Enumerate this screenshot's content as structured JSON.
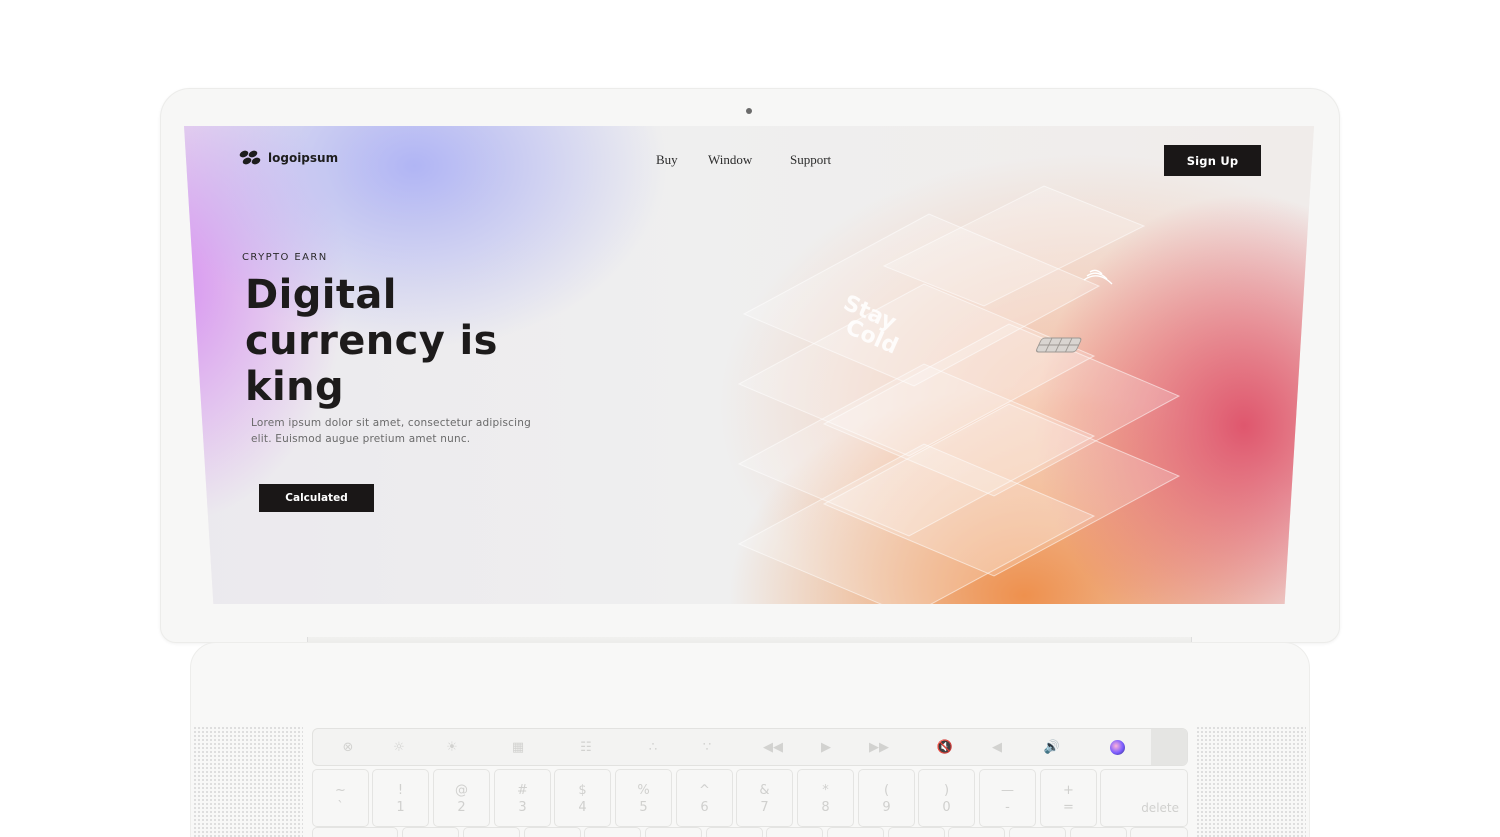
{
  "site": {
    "logo_text": "logoipsum",
    "nav": [
      "Buy",
      "Window",
      "Support"
    ],
    "signup_label": "Sign Up",
    "eyebrow": "CRYPTO EARN",
    "hero_lines": [
      "Digital",
      "currency is",
      "king"
    ],
    "lede": "Lorem ipsum dolor sit amet, consectetur adipiscing elit. Euismod augue pretium amet nunc.",
    "cta_label": "Calculated",
    "card_text": [
      "Stay",
      "Cold"
    ]
  },
  "colors": {
    "button_bg": "#1a1717",
    "gradient_purple": "#d68cf0",
    "gradient_blue": "#aaaff5",
    "gradient_red": "#de5069",
    "gradient_orange": "#ee8c46"
  },
  "keyboard": {
    "touchbar_icons": [
      "close-icon",
      "brightness-down-icon",
      "brightness-up-icon",
      "mission-control-icon",
      "launchpad-icon",
      "keyboard-light-down-icon",
      "keyboard-light-up-icon",
      "rewind-icon",
      "play-icon",
      "fast-forward-icon",
      "mute-icon",
      "volume-down-icon",
      "volume-up-icon",
      "siri-icon"
    ],
    "number_row": [
      {
        "top": "~",
        "bottom": "`"
      },
      {
        "top": "!",
        "bottom": "1"
      },
      {
        "top": "@",
        "bottom": "2"
      },
      {
        "top": "#",
        "bottom": "3"
      },
      {
        "top": "$",
        "bottom": "4"
      },
      {
        "top": "%",
        "bottom": "5"
      },
      {
        "top": "^",
        "bottom": "6"
      },
      {
        "top": "&",
        "bottom": "7"
      },
      {
        "top": "*",
        "bottom": "8"
      },
      {
        "top": "(",
        "bottom": "9"
      },
      {
        "top": ")",
        "bottom": "0"
      },
      {
        "top": "—",
        "bottom": "-"
      },
      {
        "top": "+",
        "bottom": "="
      }
    ],
    "delete_label": "delete"
  }
}
